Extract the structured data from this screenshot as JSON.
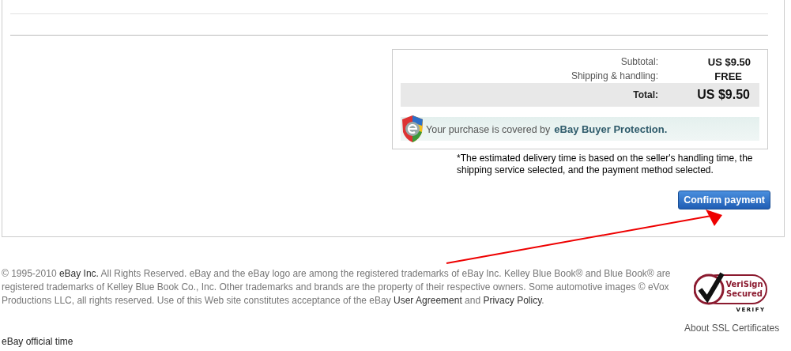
{
  "summary": {
    "rows": [
      {
        "label": "Subtotal:",
        "value": "US $9.50"
      },
      {
        "label": "Shipping & handling:",
        "value": "FREE"
      }
    ],
    "total": {
      "label": "Total:",
      "value": "US $9.50"
    },
    "protection": {
      "text": "Your purchase is covered by",
      "brand": "eBay Buyer Protection."
    }
  },
  "note": "*The estimated delivery time is based on the seller's handling time, the shipping service selected, and the payment method selected.",
  "confirm_button": "Confirm payment",
  "footer": {
    "legal": [
      {
        "kind": "text",
        "text": "© 1995-2010 "
      },
      {
        "kind": "link",
        "text": "eBay Inc."
      },
      {
        "kind": "text",
        "text": " All Rights Reserved. eBay and the eBay logo are among the registered trademarks of eBay Inc. Kelley Blue Book® and Blue Book® are registered trademarks of Kelley Blue Book Co., Inc. Other trademarks and brands are the property of their respective owners. Some automotive images © eVox Productions LLC, all rights reserved. Use of this Web site constitutes acceptance of the eBay "
      },
      {
        "kind": "link",
        "text": "User Agreement"
      },
      {
        "kind": "text",
        "text": " and "
      },
      {
        "kind": "link",
        "text": "Privacy Policy"
      },
      {
        "kind": "text",
        "text": "."
      }
    ],
    "seal": {
      "line1": "VeriSign",
      "line2": "Secured",
      "verify": "VERIFY"
    },
    "ssl_link": "About SSL Certificates",
    "official_time": "eBay official time"
  }
}
